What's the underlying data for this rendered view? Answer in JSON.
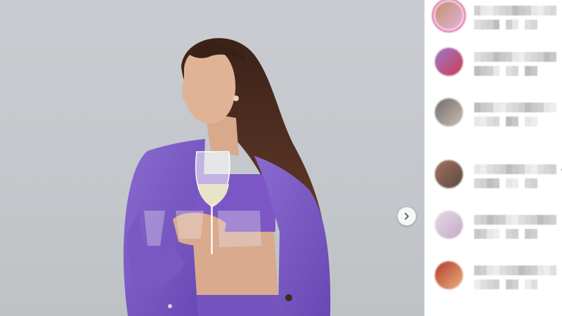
{
  "post_image": {
    "background": "#c6c9cd",
    "subject": {
      "blazer_color": "#7d5cc4",
      "hair_color": "#4a2a1e"
    }
  },
  "navigation": {
    "next_icon": "chevron-right-icon"
  },
  "comments": [
    {
      "avatar_colors": [
        "#c0906e",
        "#e6b4d8"
      ],
      "ring": true,
      "tail_line1": "",
      "tail_line2": ""
    },
    {
      "avatar_colors": [
        "#9b79c9",
        "#cf3b53"
      ],
      "ring": false,
      "tail_line1": "",
      "tail_line2": ""
    },
    {
      "avatar_colors": [
        "#6e6a6a",
        "#cdbfb3"
      ],
      "ring": false,
      "tail_line1": "",
      "tail_line2": ""
    },
    {
      "avatar_colors": [
        "#a3705e",
        "#5a4a44"
      ],
      "ring": false,
      "tail_line1": "e",
      "tail_line2": ""
    },
    {
      "avatar_colors": [
        "#e3dce6",
        "#c6a8c4"
      ],
      "ring": false,
      "tail_line1": "",
      "tail_line2": ""
    },
    {
      "avatar_colors": [
        "#b63a2f",
        "#e9b27b"
      ],
      "ring": false,
      "tail_line1": "L",
      "tail_line2": ""
    }
  ]
}
